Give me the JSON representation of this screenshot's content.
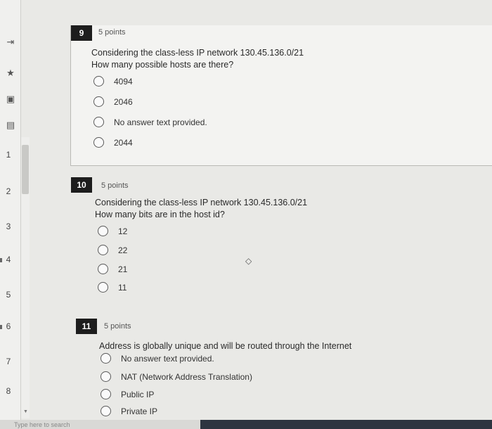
{
  "sidebar": {
    "icons": [
      "arrow-to-right-icon",
      "star-icon",
      "calculator-icon",
      "id-card-icon"
    ],
    "question_numbers": [
      "1",
      "2",
      "3",
      "4",
      "5",
      "6",
      "7",
      "8"
    ]
  },
  "questions": [
    {
      "number": "9",
      "points": "5 points",
      "line1": "Considering the class-less IP network 130.45.136.0/21",
      "line2": "How many possible hosts are there?",
      "options": [
        "4094",
        "2046",
        "No answer text provided.",
        "2044"
      ]
    },
    {
      "number": "10",
      "points": "5 points",
      "line1": "Considering the class-less IP network 130.45.136.0/21",
      "line2": "How many bits are in the host id?",
      "options": [
        "12",
        "22",
        "21",
        "11"
      ]
    },
    {
      "number": "11",
      "points": "5 points",
      "line1": "Address is globally unique and will be routed through the Internet",
      "line2": "",
      "options": [
        "No answer text provided.",
        "NAT (Network Address Translation)",
        "Public IP",
        "Private IP"
      ]
    }
  ],
  "taskbar": {
    "search_placeholder": "Type here to search"
  }
}
